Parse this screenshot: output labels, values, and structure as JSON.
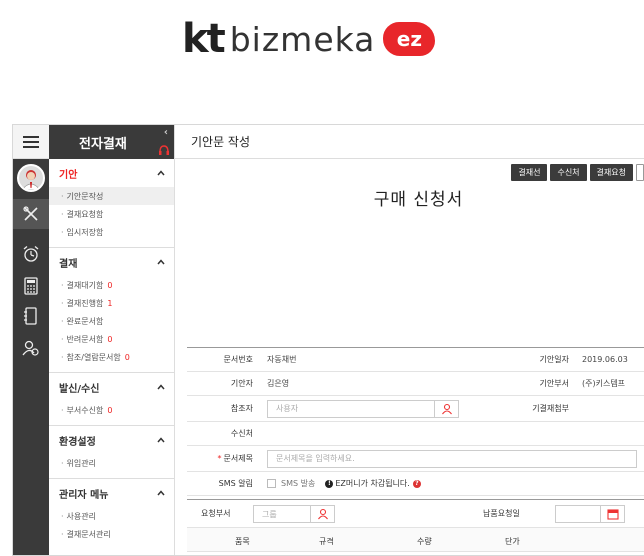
{
  "logo": {
    "kt": "kt",
    "name": "bizmeka",
    "badge": "ez"
  },
  "menu": {
    "title": "전자결재",
    "sections": [
      {
        "title": "기안",
        "items": [
          {
            "label": "기안문작성",
            "count": ""
          },
          {
            "label": "결재요청함",
            "count": ""
          },
          {
            "label": "임시저장함",
            "count": ""
          }
        ]
      },
      {
        "title": "결재",
        "items": [
          {
            "label": "결재대기함",
            "count": "0"
          },
          {
            "label": "결재진행함",
            "count": "1"
          },
          {
            "label": "완료문서함",
            "count": ""
          },
          {
            "label": "반려문서함",
            "count": "0"
          },
          {
            "label": "참조/열람문서함",
            "count": "0"
          }
        ]
      },
      {
        "title": "발신/수신",
        "items": [
          {
            "label": "부서수신함",
            "count": "0"
          }
        ]
      },
      {
        "title": "환경설정",
        "items": [
          {
            "label": "위임관리",
            "count": ""
          }
        ]
      },
      {
        "title": "관리자 메뉴",
        "items": [
          {
            "label": "사용관리",
            "count": ""
          },
          {
            "label": "결재문서관리",
            "count": ""
          }
        ]
      }
    ]
  },
  "main": {
    "page_title": "기안문 작성",
    "buttons": [
      "결재선",
      "수신처",
      "결재요청"
    ],
    "doc_title": "구매 신청서"
  },
  "form": {
    "doc_no_label": "문서번호",
    "doc_no_value": "자동채번",
    "date_label": "기안일자",
    "date_value": "2019.06.03",
    "drafter_label": "기안자",
    "drafter_value": "김은영",
    "dept_label": "기안부서",
    "dept_value": "(주)키스템프",
    "ref_label": "참조자",
    "ref_placeholder": "사용자",
    "attach_label": "기결재첨부",
    "recv_label": "수신처",
    "subject_label": "문서제목",
    "subject_placeholder": "문서제목을 입력하세요.",
    "sms_label": "SMS 알림",
    "sms_option": "SMS 발송",
    "sms_note": "EZ머니가 차감됩니다."
  },
  "request": {
    "dept_label": "요청부서",
    "dept_placeholder": "그룹",
    "due_label": "납품요청일",
    "columns": [
      "품목",
      "규격",
      "수량",
      "단가"
    ]
  },
  "colors": {
    "accent": "#e22222",
    "dark": "#3a3a3a",
    "logo_red": "#e8262a"
  }
}
